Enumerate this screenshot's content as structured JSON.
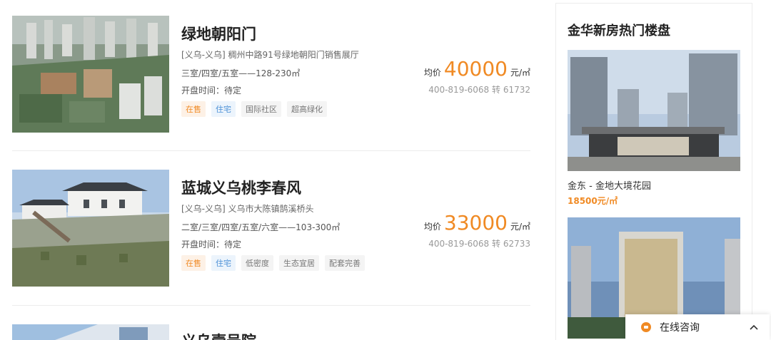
{
  "listings": [
    {
      "title": "绿地朝阳门",
      "address": "[义乌-义乌] 稠州中路91号绿地朝阳门销售展厅",
      "rooms": "三室/四室/五室——128-230㎡",
      "opening": "开盘时间：待定",
      "tags": [
        "在售",
        "住宅",
        "国际社区",
        "超高绿化"
      ],
      "price_prefix": "均价",
      "price": "40000",
      "price_unit": "元/㎡",
      "phone": "400-819-6068 转 61732"
    },
    {
      "title": "蓝城义乌桃李春风",
      "address": "[义乌-义乌] 义乌市大陈镇鹄溪桥头",
      "rooms": "二室/三室/四室/五室/六室——103-300㎡",
      "opening": "开盘时间：待定",
      "tags": [
        "在售",
        "住宅",
        "低密度",
        "生态宜居",
        "配套完善"
      ],
      "price_prefix": "均价",
      "price": "33000",
      "price_unit": "元/㎡",
      "phone": "400-819-6068 转 62733"
    },
    {
      "title": "义乌壹号院"
    }
  ],
  "sidebar": {
    "title": "金华新房热门楼盘",
    "items": [
      {
        "name": "金东 - 金地大境花园",
        "price": "18500元/㎡"
      },
      {
        "name": "",
        "price": ""
      }
    ]
  },
  "consult": {
    "label": "在线咨询",
    "icon": "chat-bubble-icon"
  },
  "colors": {
    "accent": "#f08a24",
    "tag_sale_bg": "#fdf1e6",
    "tag_house_text": "#4a8fd6"
  }
}
